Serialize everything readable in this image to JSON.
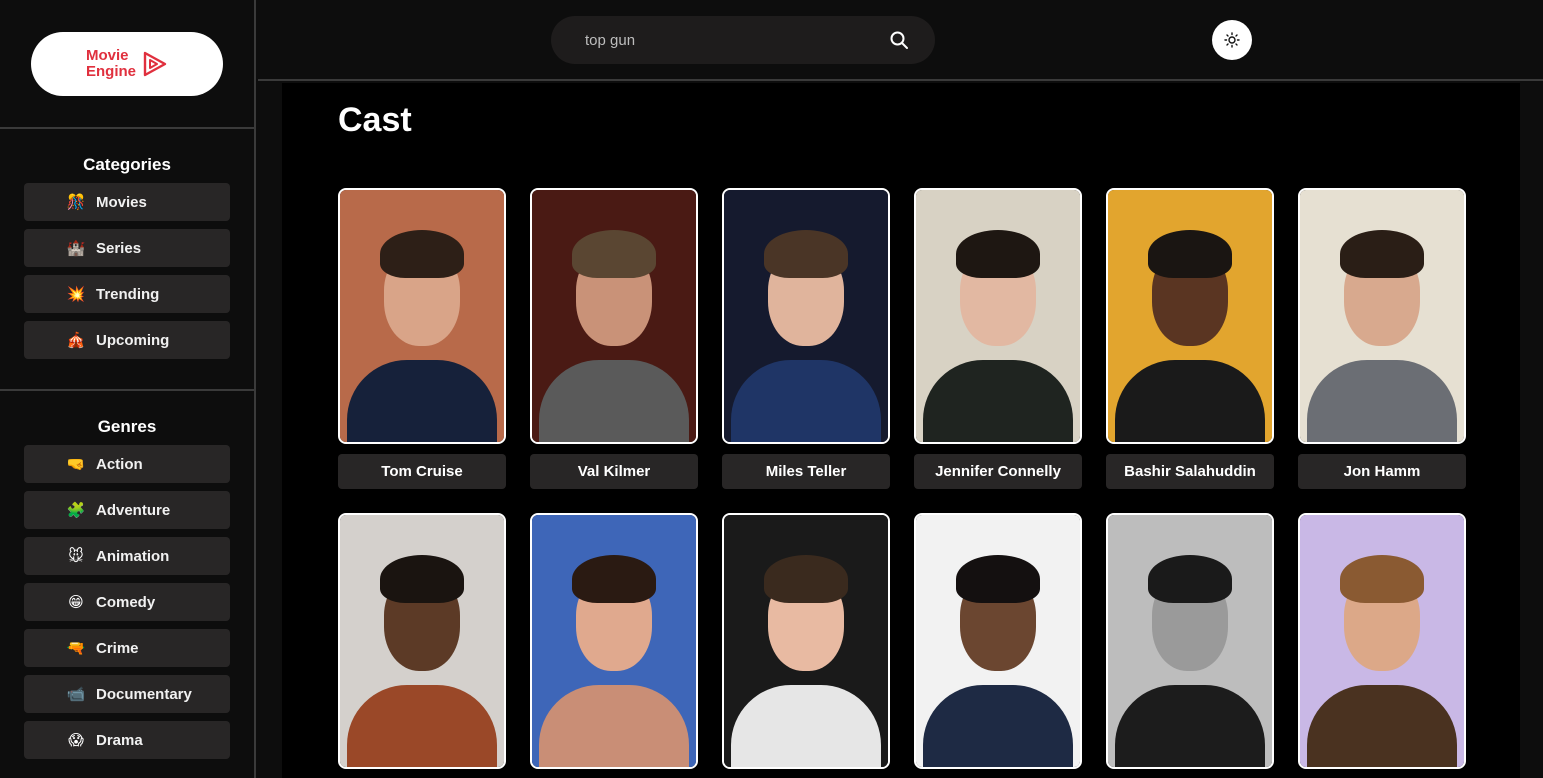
{
  "logo": {
    "line1": "Movie",
    "line2": "Engine"
  },
  "search": {
    "value": "top gun"
  },
  "categories": {
    "title": "Categories",
    "items": [
      {
        "label": "Movies",
        "icon": "🎊"
      },
      {
        "label": "Series",
        "icon": "🏰"
      },
      {
        "label": "Trending",
        "icon": "💥"
      },
      {
        "label": "Upcoming",
        "icon": "🎪"
      }
    ]
  },
  "genres": {
    "title": "Genres",
    "items": [
      {
        "label": "Action",
        "icon": "🤜"
      },
      {
        "label": "Adventure",
        "icon": "🧩"
      },
      {
        "label": "Animation",
        "icon": "🐭"
      },
      {
        "label": "Comedy",
        "icon": "😁"
      },
      {
        "label": "Crime",
        "icon": "🔫"
      },
      {
        "label": "Documentary",
        "icon": "📹"
      },
      {
        "label": "Drama",
        "icon": "😱"
      }
    ]
  },
  "main": {
    "title": "Cast",
    "cast": [
      {
        "name": "Tom Cruise",
        "bg": "#b86a4a",
        "skin": "#d9a488",
        "hair": "#2d1f17",
        "suit": "#16213a"
      },
      {
        "name": "Val Kilmer",
        "bg": "#4a1a14",
        "skin": "#c99278",
        "hair": "#5a4632",
        "suit": "#5a5a5a"
      },
      {
        "name": "Miles Teller",
        "bg": "#151a2e",
        "skin": "#e0b49c",
        "hair": "#4a3526",
        "suit": "#1f3566"
      },
      {
        "name": "Jennifer Connelly",
        "bg": "#d8d2c4",
        "skin": "#e2b8a2",
        "hair": "#1e1712",
        "suit": "#1f2420"
      },
      {
        "name": "Bashir Salahuddin",
        "bg": "#e2a52e",
        "skin": "#5a3522",
        "hair": "#1a1512",
        "suit": "#1a1a1a"
      },
      {
        "name": "Jon Hamm",
        "bg": "#e6e0d2",
        "skin": "#d8a98e",
        "hair": "#2a1e16",
        "suit": "#6b6e74"
      },
      {
        "name": "",
        "bg": "#d4d0cc",
        "skin": "#5c3a26",
        "hair": "#1a1410",
        "suit": "#9a4828"
      },
      {
        "name": "",
        "bg": "#3e66b8",
        "skin": "#e0a98e",
        "hair": "#2a1a12",
        "suit": "#c98e76"
      },
      {
        "name": "",
        "bg": "#1a1a1a",
        "skin": "#e8baa2",
        "hair": "#3a2a1e",
        "suit": "#e6e6e6"
      },
      {
        "name": "",
        "bg": "#f2f2f2",
        "skin": "#6b4630",
        "hair": "#141010",
        "suit": "#1e2a44"
      },
      {
        "name": "",
        "bg": "#bdbdbd",
        "skin": "#9a9a9a",
        "hair": "#1a1a1a",
        "suit": "#1c1c1c"
      },
      {
        "name": "",
        "bg": "#c9b8e6",
        "skin": "#dca888",
        "hair": "#8a5a32",
        "suit": "#4a3220"
      }
    ]
  }
}
